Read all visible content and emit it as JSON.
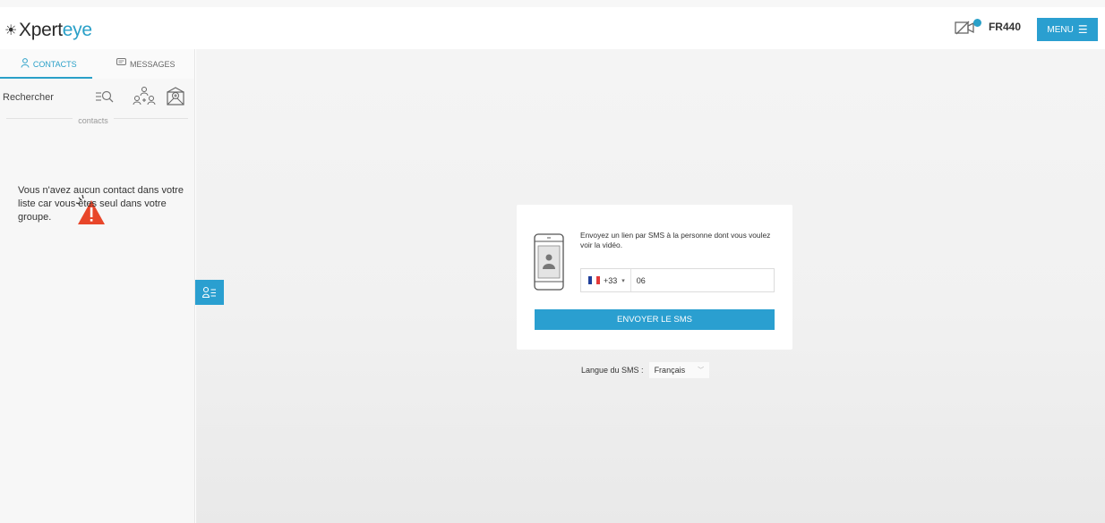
{
  "header": {
    "logo": {
      "part1": "Xpert",
      "part2": "eye"
    },
    "user_code": "FR440",
    "menu_label": "MENU",
    "menu_icon": "hamburger-icon",
    "video_icon": "video-off-icon"
  },
  "sidebar": {
    "tabs": [
      {
        "label": "CONTACTS",
        "icon": "user-icon"
      },
      {
        "label": "MESSAGES",
        "icon": "chat-icon"
      }
    ],
    "search": {
      "placeholder": "Rechercher"
    },
    "contacts_caption": "contacts",
    "empty_message": "Vous n'avez aucun contact dans votre liste car vous êtes seul dans votre groupe."
  },
  "sms_card": {
    "description": "Envoyez un lien par SMS à la personne dont vous voulez voir la vidéo.",
    "country_code": "+33",
    "phone_value": "06",
    "send_label": "ENVOYER LE SMS"
  },
  "language": {
    "label": "Langue du SMS :",
    "selected": "Français"
  },
  "colors": {
    "accent": "#2a9fd0",
    "warning": "#e8462a"
  }
}
